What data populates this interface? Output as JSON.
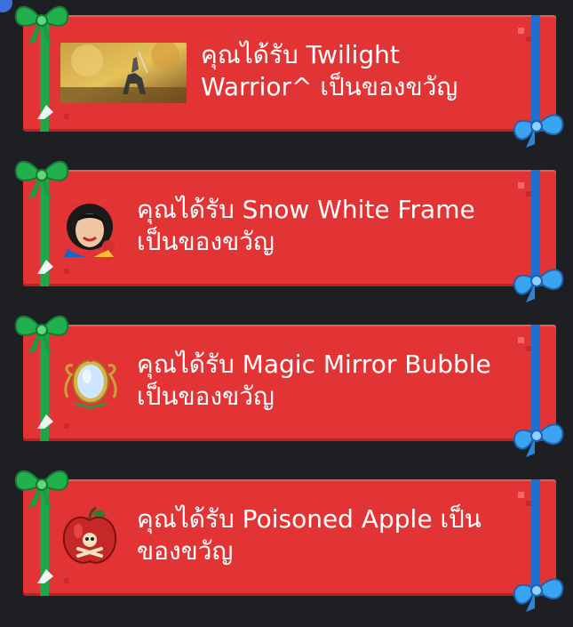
{
  "gifts": [
    {
      "message": "คุณได้รับ Twilight\nWarrior^ เป็นของขวัญ",
      "item": "Twilight Warrior^",
      "thumb_icon": "twilight-warrior-image"
    },
    {
      "message": "คุณได้รับ Snow White Frame\nเป็นของขวัญ",
      "item": "Snow White Frame",
      "thumb_icon": "snow-white-avatar-frame"
    },
    {
      "message": "คุณได้รับ Magic Mirror Bubble\nเป็นของขวัญ",
      "item": "Magic Mirror Bubble",
      "thumb_icon": "magic-mirror-icon"
    },
    {
      "message": "คุณได้รับ Poisoned Apple เป็น\nของขวัญ",
      "item": "Poisoned Apple",
      "thumb_icon": "poisoned-apple-icon"
    }
  ],
  "colors": {
    "card": "#e23434",
    "ribbon_green": "#1fa54a",
    "ribbon_blue": "#1f6fd0",
    "background": "#1e1f22"
  }
}
